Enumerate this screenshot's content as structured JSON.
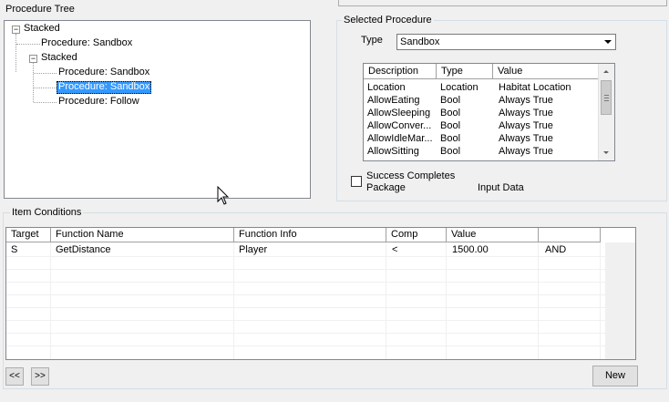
{
  "procedure_tree": {
    "title": "Procedure Tree",
    "nodes": [
      {
        "label": "Stacked"
      },
      {
        "label": "Procedure: Sandbox"
      },
      {
        "label": "Stacked"
      },
      {
        "label": "Procedure: Sandbox"
      },
      {
        "label": "Procedure: Sandbox"
      },
      {
        "label": "Procedure: Follow"
      }
    ]
  },
  "selected_procedure": {
    "title": "Selected Procedure",
    "type_label": "Type",
    "type_value": "Sandbox",
    "columns": [
      "Description",
      "Type",
      "Value"
    ],
    "rows": [
      {
        "description": "Location",
        "type": "Location",
        "value": "Habitat Location"
      },
      {
        "description": "AllowEating",
        "type": "Bool",
        "value": "Always True"
      },
      {
        "description": "AllowSleeping",
        "type": "Bool",
        "value": "Always True"
      },
      {
        "description": "AllowConver...",
        "type": "Bool",
        "value": "Always True"
      },
      {
        "description": "AllowIdleMar...",
        "type": "Bool",
        "value": "Always True"
      },
      {
        "description": "AllowSitting",
        "type": "Bool",
        "value": "Always True"
      }
    ],
    "success_label_line1": "Success Completes",
    "success_label_line2": "Package",
    "input_data_label": "Input Data"
  },
  "item_conditions": {
    "title": "Item Conditions",
    "columns": [
      "Target",
      "Function Name",
      "Function Info",
      "Comp",
      "Value",
      ""
    ],
    "rows": [
      {
        "target": "S",
        "function_name": "GetDistance",
        "function_info": "Player",
        "comp": "<",
        "value": "1500.00",
        "op": "AND"
      }
    ],
    "prev_button": "<<",
    "next_button": ">>",
    "new_button": "New"
  }
}
